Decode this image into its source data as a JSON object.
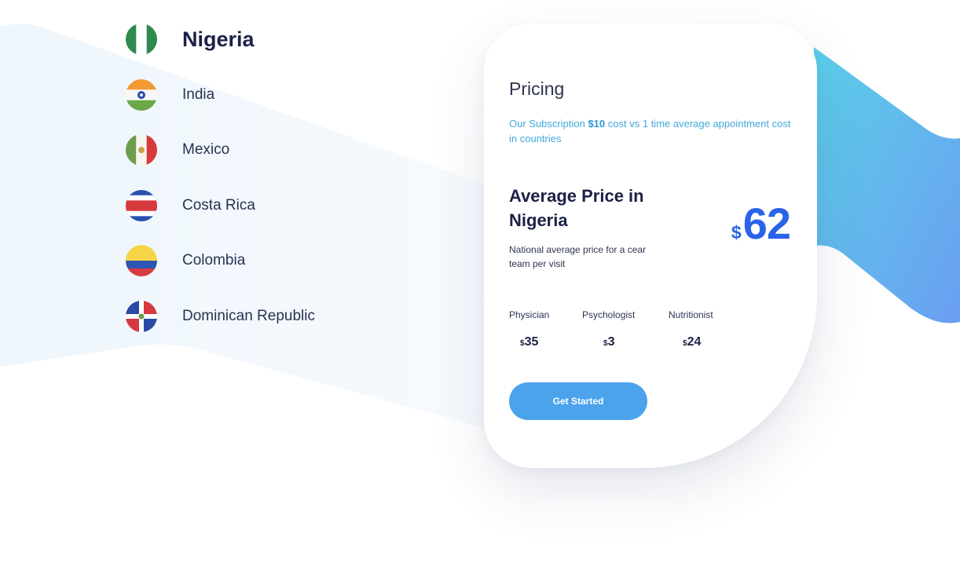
{
  "countries": [
    {
      "name": "Nigeria",
      "flag": "nigeria-flag-icon",
      "active": true
    },
    {
      "name": "India",
      "flag": "india-flag-icon",
      "active": false
    },
    {
      "name": "Mexico",
      "flag": "mexico-flag-icon",
      "active": false
    },
    {
      "name": "Costa Rica",
      "flag": "costa-rica-flag-icon",
      "active": false
    },
    {
      "name": "Colombia",
      "flag": "colombia-flag-icon",
      "active": false
    },
    {
      "name": "Dominican Republic",
      "flag": "dominican-republic-flag-icon",
      "active": false
    }
  ],
  "pricing": {
    "heading": "Pricing",
    "subscription_prefix": "Our Subscription",
    "subscription_price": "$10",
    "subscription_suffix": "cost vs 1 time average appointment cost in countries",
    "average_title": "Average Price in Nigeria",
    "average_description": "National average price for a cear team per visit",
    "currency_symbol": "$",
    "average_price": "62",
    "specialists": [
      {
        "label": "Physician",
        "currency": "$",
        "price": "35"
      },
      {
        "label": "Psychologist",
        "currency": "$",
        "price": "3"
      },
      {
        "label": "Nutritionist",
        "currency": "$",
        "price": "24"
      }
    ],
    "cta_label": "Get Started"
  },
  "colors": {
    "accent_blue": "#2b63e8",
    "button_blue": "#4ba3ec",
    "subscription_text": "#43a8dc",
    "heading_navy": "#1b2146",
    "gradient_start": "#5ccfea",
    "gradient_end": "#6a9ef0"
  }
}
